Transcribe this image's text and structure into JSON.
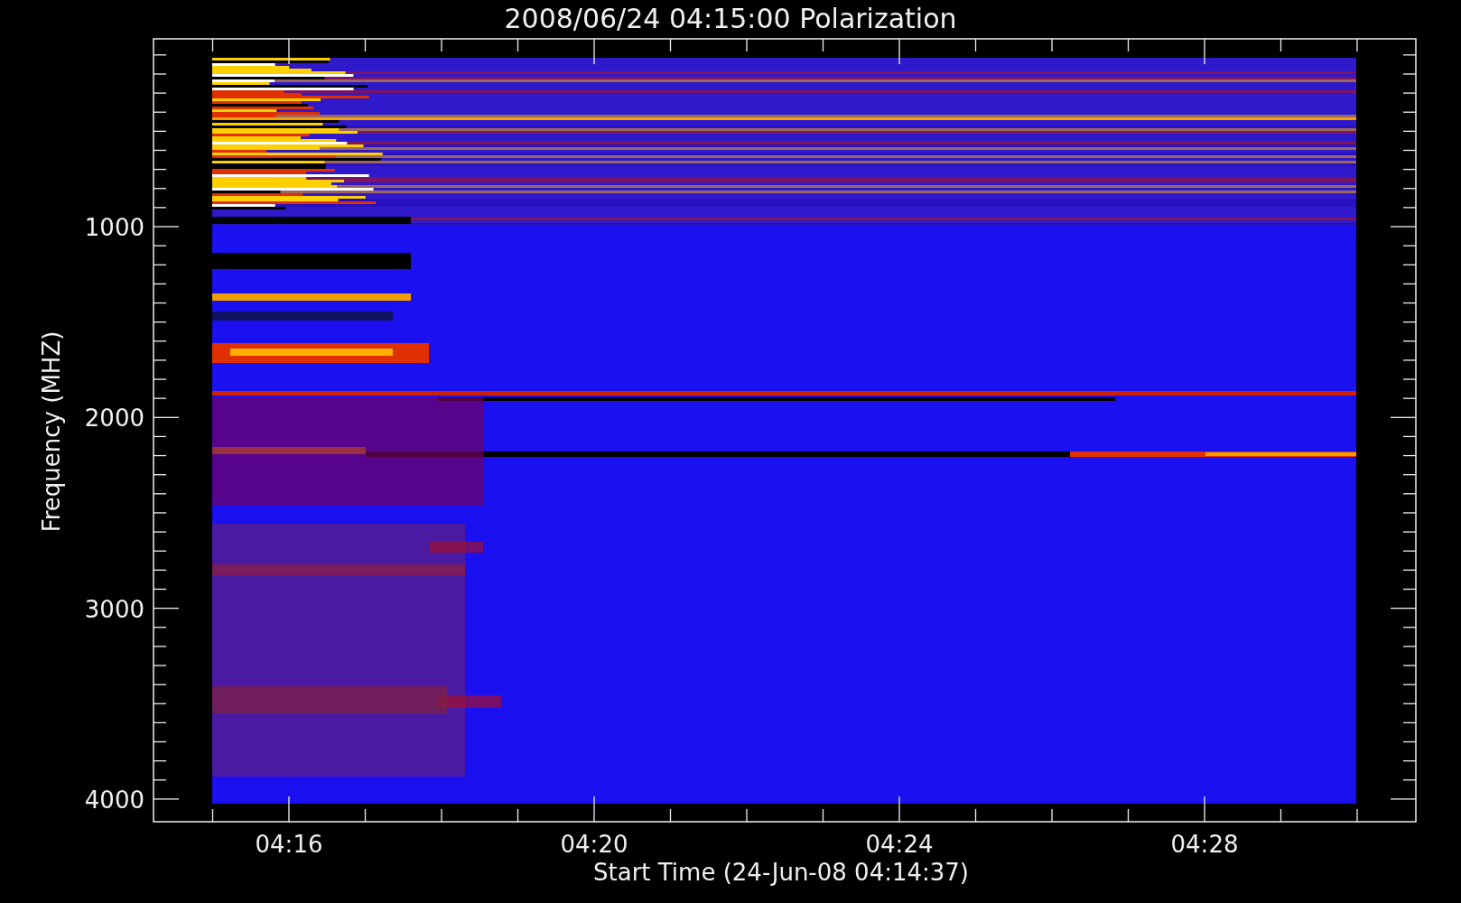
{
  "title": "2008/06/24 04:15:00 Polarization",
  "ylabel": "Frequency (MHZ)",
  "xlabel": "Start Time (24-Jun-08 04:14:37)",
  "yticks": [
    "1000",
    "2000",
    "3000",
    "4000"
  ],
  "xticks": [
    "04:16",
    "04:20",
    "04:24",
    "04:28"
  ]
}
